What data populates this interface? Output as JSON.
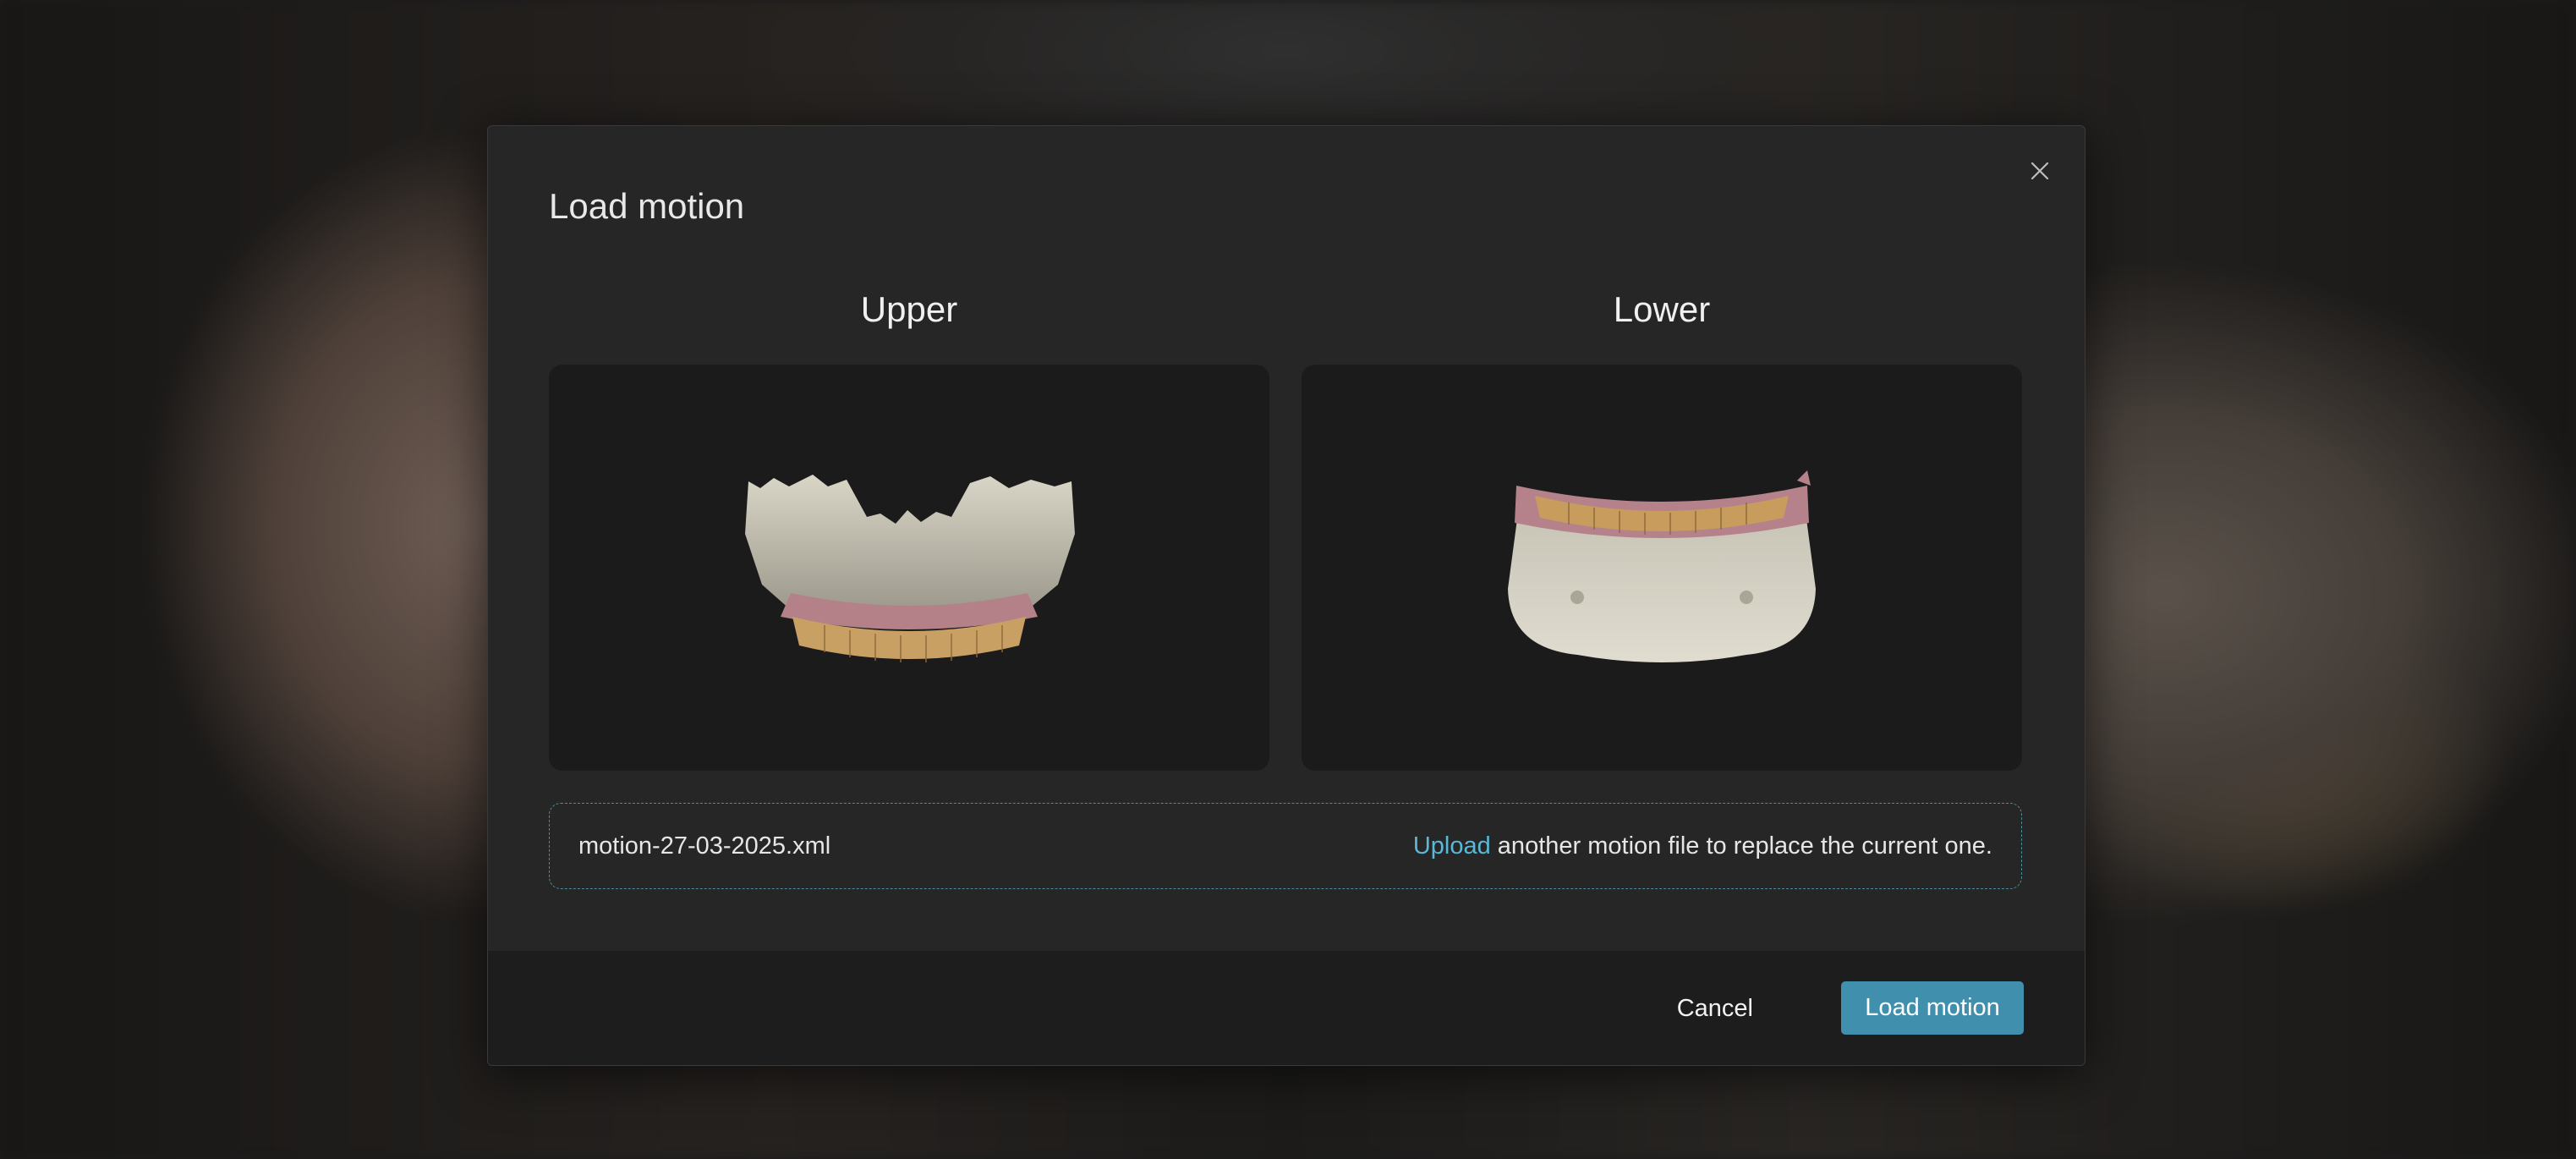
{
  "dialog": {
    "title": "Load motion",
    "close_icon": "close-icon"
  },
  "previews": {
    "upper": {
      "label": "Upper"
    },
    "lower": {
      "label": "Lower"
    }
  },
  "file": {
    "name": "motion-27-03-2025.xml",
    "upload_link": "Upload",
    "upload_text": " another motion file to replace the current one."
  },
  "footer": {
    "cancel_label": "Cancel",
    "load_label": "Load motion"
  },
  "colors": {
    "accent": "#3f8fad",
    "link": "#5ab8d6",
    "dialog_bg": "#262626",
    "preview_bg": "#1b1b1b"
  }
}
